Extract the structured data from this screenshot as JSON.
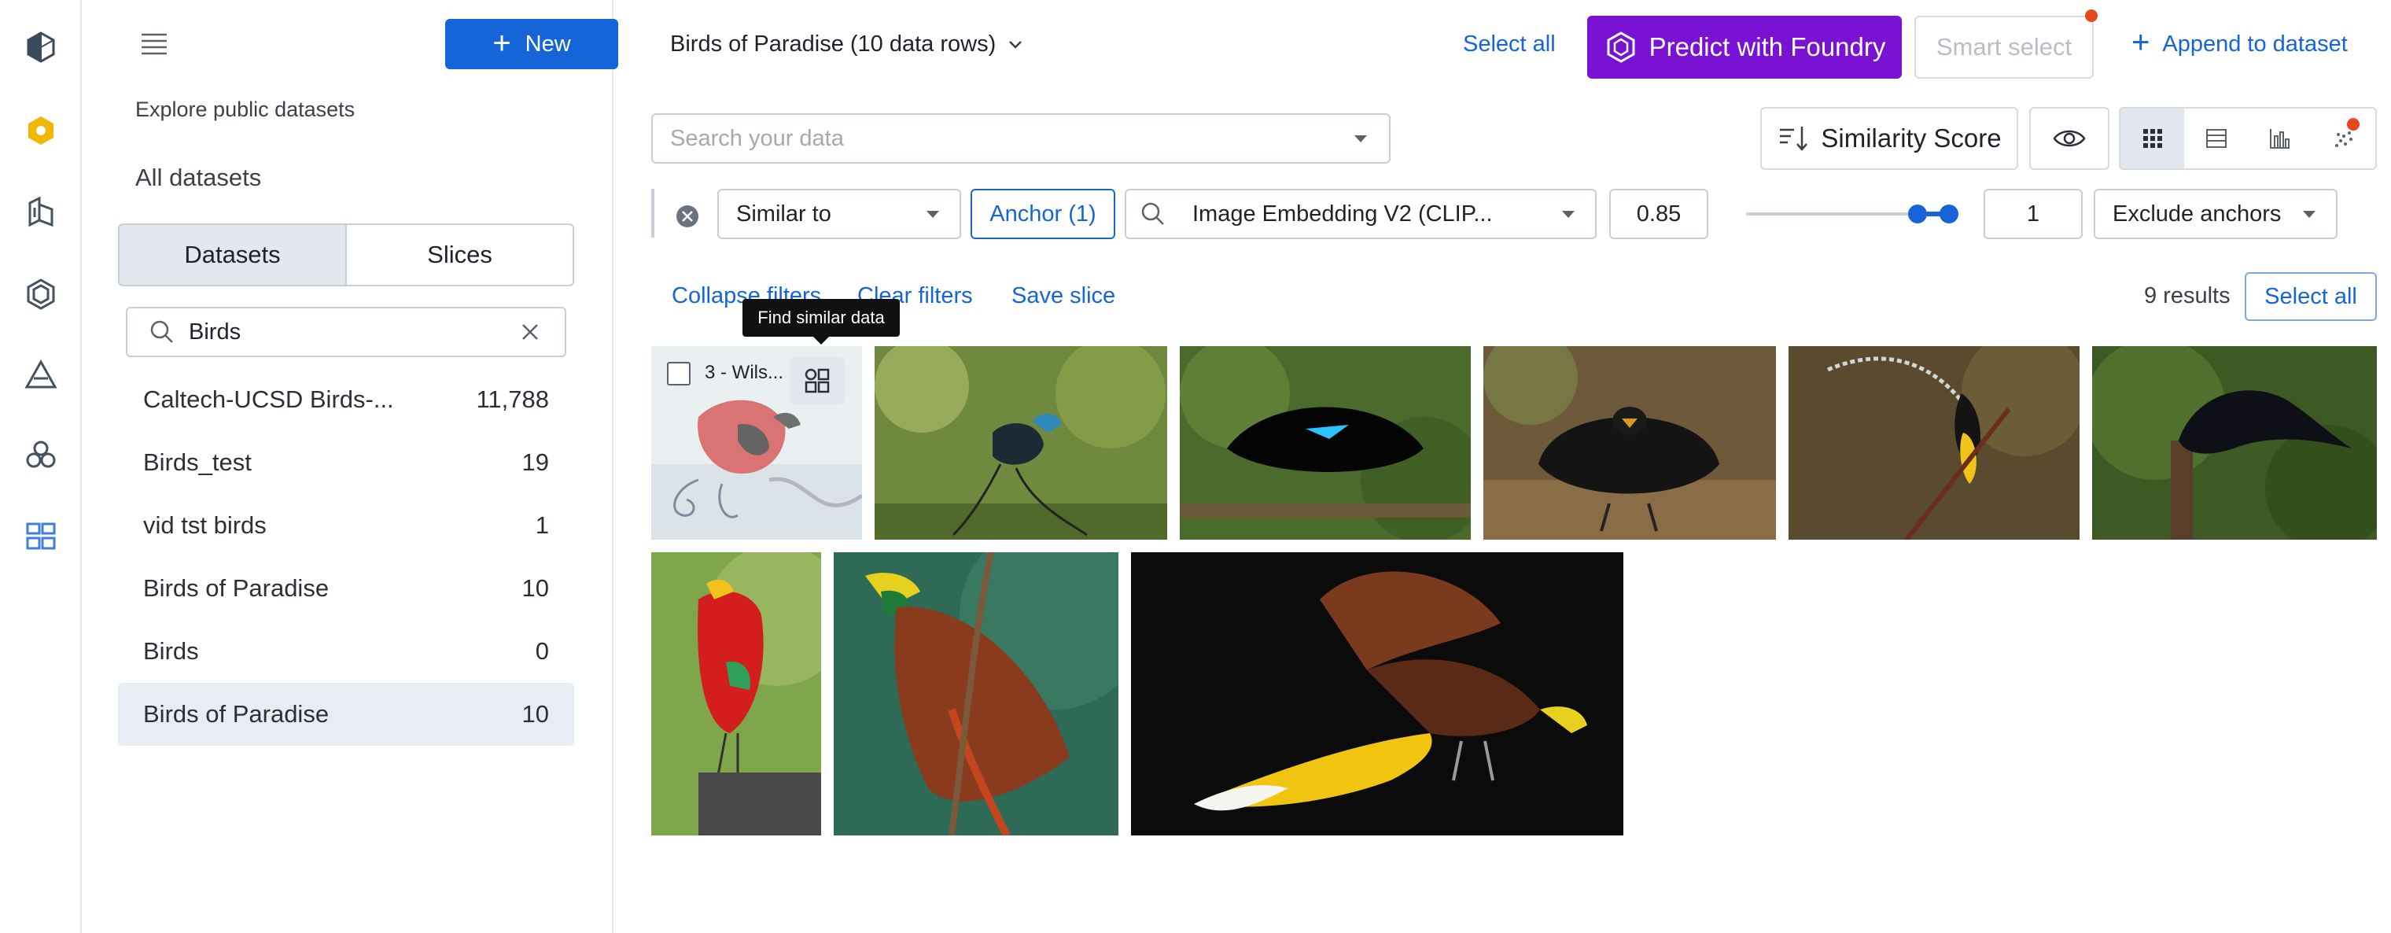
{
  "rail": {
    "icons": [
      "cube-icon",
      "foundry-logo-icon",
      "data-icon",
      "hexagon-icon",
      "triangle-icon",
      "cluster-icon",
      "dashboard-icon"
    ]
  },
  "sidebar": {
    "new_label": "New",
    "explore_link": "Explore public datasets",
    "all_datasets": "All datasets",
    "tabs": [
      "Datasets",
      "Slices"
    ],
    "active_tab": "Datasets",
    "search_value": "Birds",
    "datasets": [
      {
        "name": "Caltech-UCSD Birds-...",
        "count": "11,788"
      },
      {
        "name": "Birds_test",
        "count": "19"
      },
      {
        "name": "vid tst birds",
        "count": "1"
      },
      {
        "name": "Birds of Paradise",
        "count": "10"
      },
      {
        "name": "Birds",
        "count": "0"
      },
      {
        "name": "Birds of Paradise",
        "count": "10",
        "selected": true
      }
    ]
  },
  "header": {
    "dataset_title": "Birds of Paradise (10 data rows)",
    "select_all": "Select all",
    "predict_label": "Predict with Foundry",
    "smart_select": "Smart select",
    "append_label": "Append to dataset"
  },
  "toolbar": {
    "search_placeholder": "Search your data",
    "sort_label": "Similarity Score",
    "view_modes": [
      "grid",
      "list",
      "chart",
      "scatter"
    ],
    "active_view": "grid"
  },
  "filter": {
    "type": "Similar to",
    "anchor": "Anchor (1)",
    "embedding": "Image Embedding V2 (CLIP...",
    "threshold": "0.85",
    "slider_value": 0.85,
    "top_k": "1",
    "exclude": "Exclude anchors"
  },
  "actions": {
    "collapse": "Collapse filters",
    "clear": "Clear filters",
    "save_slice": "Save slice",
    "results": "9 results",
    "select_all": "Select all"
  },
  "tooltip": "Find similar data",
  "grid": {
    "first_item_label": "3 - Wils...",
    "tiles": [
      "bird-red-wilsons",
      "bird-blue-crested",
      "bird-black-superb",
      "bird-black-fan",
      "bird-twelve-wired",
      "bird-black-sicklebill",
      "bird-red-king",
      "bird-greater-red",
      "bird-greater-yellow"
    ]
  },
  "colors": {
    "accent": "#1565d8",
    "predict": "#7a12d4",
    "notification": "#e5481d",
    "selected_bg": "#e8edf3"
  }
}
